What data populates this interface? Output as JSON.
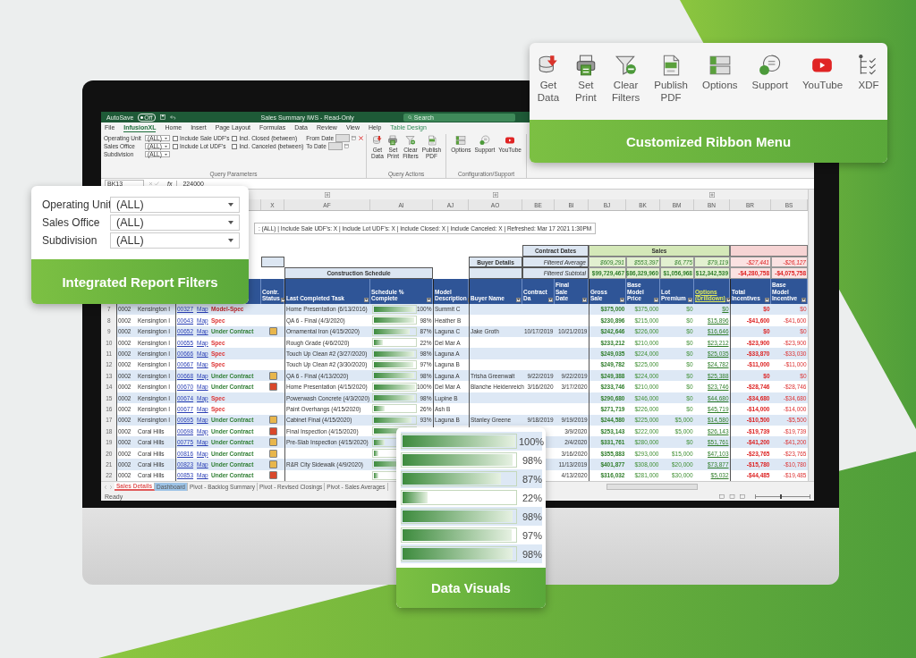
{
  "excel": {
    "title_bar": {
      "autosave": "AutoSave",
      "autosave_state": "Off",
      "autosave_on": false,
      "title": "Sales Summary IWS - Read-Only",
      "search_placeholder": "Search"
    },
    "menu": [
      {
        "label": "File",
        "selected": false,
        "kind": "tab"
      },
      {
        "label": "InfusionXL",
        "selected": true,
        "kind": "tab"
      },
      {
        "label": "Home",
        "selected": false,
        "kind": "tab"
      },
      {
        "label": "Insert",
        "selected": false,
        "kind": "tab"
      },
      {
        "label": "Page Layout",
        "selected": false,
        "kind": "tab"
      },
      {
        "label": "Formulas",
        "selected": false,
        "kind": "tab"
      },
      {
        "label": "Data",
        "selected": false,
        "kind": "tab"
      },
      {
        "label": "Review",
        "selected": false,
        "kind": "tab"
      },
      {
        "label": "View",
        "selected": false,
        "kind": "tab"
      },
      {
        "label": "Help",
        "selected": false,
        "kind": "tab"
      },
      {
        "label": "Table Design",
        "selected": false,
        "kind": "contextual"
      }
    ],
    "ribbon": {
      "filters": [
        {
          "label": "Operating Unit",
          "value": "(ALL)"
        },
        {
          "label": "Sales Office",
          "value": "(ALL)"
        },
        {
          "label": "Subdivision",
          "value": "(ALL)"
        }
      ],
      "checkboxes": [
        {
          "label": "Include Sale UDF's",
          "checked": false
        },
        {
          "label": "Include Lot UDF's",
          "checked": false
        },
        {
          "label": "Incl. Closed (between)",
          "checked": false
        },
        {
          "label": "Incl. Canceled (between)",
          "checked": false
        }
      ],
      "dates": [
        {
          "label": "From Date",
          "disabled": true
        },
        {
          "label": "To Date",
          "disabled": true
        }
      ],
      "query_parameters_label": "Query Parameters",
      "query_actions": {
        "label": "Query Actions",
        "buttons": [
          {
            "label": "Get Data",
            "kind": "database"
          },
          {
            "label": "Set Print",
            "kind": "printer"
          },
          {
            "label": "Clear Filters",
            "kind": "funnel"
          },
          {
            "label": "Publish PDF",
            "kind": "pdf"
          }
        ]
      },
      "configuration": {
        "label": "Configuration/Support",
        "buttons": [
          {
            "label": "Options",
            "kind": "options"
          },
          {
            "label": "Support",
            "kind": "support"
          },
          {
            "label": "YouTube",
            "kind": "youtube"
          }
        ]
      }
    },
    "formula_bar": {
      "name_box": "BK13",
      "function_label": "fx",
      "value": "224000"
    },
    "sheet": {
      "columns": [
        {
          "letter": "X",
          "heading": "Contr. Status"
        },
        {
          "letter": "AF",
          "heading": "Last Completed Task"
        },
        {
          "letter": "AI",
          "heading": "Schedule % Complete"
        },
        {
          "letter": "AJ",
          "heading": "Model Description"
        },
        {
          "letter": "AO",
          "heading": "Buyer Name"
        },
        {
          "letter": "BE",
          "heading": "Contract Da"
        },
        {
          "letter": "BI",
          "heading": "Final Sale Date"
        },
        {
          "letter": "BJ",
          "heading": "Gross Sale"
        },
        {
          "letter": "BK",
          "heading": "Base Model Price"
        },
        {
          "letter": "BM",
          "heading": "Lot Premium"
        },
        {
          "letter": "BN",
          "heading": "Options (Drilldown)"
        },
        {
          "letter": "BR",
          "heading": "Total Incentives"
        },
        {
          "letter": "BS",
          "heading": "Base Model Incentive"
        }
      ],
      "filter_summary": ": (ALL) | Include Sale UDF's: X | Include Lot UDF's: X | Include Closed: X | Include Canceled: X | Refreshed: Mar 17 2021 1:30PM",
      "groups": {
        "contract_dates": "Contract Dates",
        "sales": "Sales",
        "buyer_details": "Buyer Details",
        "construction_schedule": "Construction Schedule"
      },
      "filtered_average": {
        "label": "Filtered Average",
        "values": [
          "$609,291",
          "$553,397",
          "$6,775",
          "$79,119",
          "-$27,441",
          "-$26,127"
        ]
      },
      "filtered_subtotal": {
        "label": "Filtered Subtotal",
        "values": [
          "$99,729,467",
          "$86,329,960",
          "$1,056,968",
          "$12,342,539",
          "-$4,280,758",
          "-$4,075,758"
        ]
      },
      "rows": [
        {
          "number": "7",
          "unit": "0002",
          "community": "Kensington I",
          "lot": "00327",
          "map": "Map",
          "status": "Model-Spec",
          "kind": "model_spec",
          "task": "Home Presentation (6/13/2016)",
          "level": 1,
          "schedule": "100%",
          "model": "Summit C",
          "gross": "$375,000",
          "base_price": "$375,000",
          "lot_premium": "$0",
          "options": "$0",
          "total_incentives": "$0",
          "base_incentive": "$0"
        },
        {
          "number": "8",
          "unit": "0002",
          "community": "Kensington I",
          "lot": "00643",
          "map": "Map",
          "status": "Spec",
          "kind": "spec",
          "task": "QA 6 - Final (4/3/2020)",
          "level": 0.98,
          "schedule": "98%",
          "model": "Heather B",
          "gross": "$230,896",
          "base_price": "$215,000",
          "lot_premium": "$0",
          "options": "$15,896",
          "total_incentives": "-$41,600",
          "base_incentive": "-$41,600"
        },
        {
          "number": "9",
          "unit": "0002",
          "community": "Kensington I",
          "lot": "00652",
          "map": "Map",
          "status": "Under Contract",
          "kind": "under_contract",
          "color": "#e8b64c",
          "task": "Ornamental Iron (4/15/2020)",
          "level": 0.87,
          "schedule": "87%",
          "model": "Laguna C",
          "buyer": "Jake Groth",
          "contract_date": "10/17/2019",
          "final_date": "10/21/2019",
          "gross": "$242,646",
          "base_price": "$226,000",
          "lot_premium": "$0",
          "options": "$16,646",
          "total_incentives": "$0",
          "base_incentive": "$0"
        },
        {
          "number": "10",
          "unit": "0002",
          "community": "Kensington I",
          "lot": "00655",
          "map": "Map",
          "status": "Spec",
          "kind": "spec",
          "task": "Rough Grade (4/6/2020)",
          "level": 0.22,
          "schedule": "22%",
          "model": "Del Mar A",
          "gross": "$233,212",
          "base_price": "$210,000",
          "lot_premium": "$0",
          "options": "$23,212",
          "total_incentives": "-$23,900",
          "base_incentive": "-$23,900"
        },
        {
          "number": "11",
          "unit": "0002",
          "community": "Kensington I",
          "lot": "00666",
          "map": "Map",
          "status": "Spec",
          "kind": "spec",
          "task": "Touch Up Clean #2 (3/27/2020)",
          "level": 0.98,
          "schedule": "98%",
          "model": "Laguna A",
          "gross": "$249,035",
          "base_price": "$224,000",
          "lot_premium": "$0",
          "options": "$25,035",
          "total_incentives": "-$33,870",
          "base_incentive": "-$33,030"
        },
        {
          "number": "12",
          "unit": "0002",
          "community": "Kensington I",
          "lot": "00667",
          "map": "Map",
          "status": "Spec",
          "kind": "spec",
          "task": "Touch Up Clean #2 (3/30/2020)",
          "level": 0.97,
          "schedule": "97%",
          "model": "Laguna B",
          "gross": "$249,782",
          "base_price": "$225,000",
          "lot_premium": "$0",
          "options": "$24,782",
          "total_incentives": "-$11,000",
          "base_incentive": "-$11,000"
        },
        {
          "number": "13",
          "unit": "0002",
          "community": "Kensington I",
          "lot": "00668",
          "map": "Map",
          "status": "Under Contract",
          "kind": "under_contract",
          "color": "#e8b64c",
          "task": "QA 6 - Final (4/13/2020)",
          "level": 0.98,
          "schedule": "98%",
          "model": "Laguna A",
          "buyer": "Trisha Greenwalt",
          "contract_date": "9/22/2019",
          "final_date": "9/22/2019",
          "gross": "$249,388",
          "base_price": "$224,000",
          "lot_premium": "$0",
          "options": "$25,388",
          "total_incentives": "$0",
          "base_incentive": "$0"
        },
        {
          "number": "14",
          "unit": "0002",
          "community": "Kensington I",
          "lot": "00670",
          "map": "Map",
          "status": "Under Contract",
          "kind": "under_contract",
          "color": "#d9482b",
          "task": "Home Presentation (4/15/2020)",
          "level": 1,
          "schedule": "100%",
          "model": "Del Mar A",
          "buyer": "Blanche Heidenreich",
          "contract_date": "3/16/2020",
          "final_date": "3/17/2020",
          "gross": "$233,746",
          "base_price": "$210,000",
          "lot_premium": "$0",
          "options": "$23,746",
          "total_incentives": "-$28,746",
          "base_incentive": "-$28,746"
        },
        {
          "number": "15",
          "unit": "0002",
          "community": "Kensington I",
          "lot": "00674",
          "map": "Map",
          "status": "Spec",
          "kind": "spec",
          "task": "Powerwash Concrete (4/3/2020)",
          "level": 0.98,
          "schedule": "98%",
          "model": "Lupine B",
          "gross": "$290,680",
          "base_price": "$246,000",
          "lot_premium": "$0",
          "options": "$44,680",
          "total_incentives": "-$34,680",
          "base_incentive": "-$34,680"
        },
        {
          "number": "16",
          "unit": "0002",
          "community": "Kensington I",
          "lot": "00677",
          "map": "Map",
          "status": "Spec",
          "kind": "spec",
          "task": "Paint Overhangs (4/15/2020)",
          "level": 0.26,
          "schedule": "26%",
          "model": "Ash B",
          "gross": "$271,719",
          "base_price": "$226,000",
          "lot_premium": "$0",
          "options": "$45,719",
          "total_incentives": "-$14,000",
          "base_incentive": "-$14,000"
        },
        {
          "number": "17",
          "unit": "0002",
          "community": "Kensington I",
          "lot": "00695",
          "map": "Map",
          "status": "Under Contract",
          "kind": "under_contract",
          "color": "#e8b64c",
          "task": "Cabinet Final (4/15/2020)",
          "level": 0.93,
          "schedule": "93%",
          "model": "Laguna B",
          "buyer": "Stanley Greene",
          "contract_date": "9/18/2019",
          "final_date": "9/19/2019",
          "gross": "$244,580",
          "base_price": "$225,000",
          "lot_premium": "$5,000",
          "options": "$14,580",
          "total_incentives": "-$10,500",
          "base_incentive": "-$5,500"
        },
        {
          "number": "18",
          "unit": "0002",
          "community": "Coral Hills",
          "lot": "00698",
          "map": "Map",
          "status": "Under Contract",
          "kind": "under_contract",
          "color": "#d9482b",
          "task": "Final Inspection (4/15/2020)",
          "level": 0.95,
          "final_date": "3/9/2020",
          "gross": "$253,143",
          "base_price": "$222,000",
          "lot_premium": "$5,000",
          "options": "$26,143",
          "total_incentives": "-$19,739",
          "base_incentive": "-$19,739"
        },
        {
          "number": "19",
          "unit": "0002",
          "community": "Coral Hills",
          "lot": "00775",
          "map": "Map",
          "status": "Under Contract",
          "kind": "under_contract",
          "color": "#e8b64c",
          "task": "Pre-Slab Inspection (4/15/2020)",
          "level": 0.26,
          "final_date": "2/4/2020",
          "gross": "$331,761",
          "base_price": "$280,000",
          "lot_premium": "$0",
          "options": "$51,761",
          "total_incentives": "-$41,200",
          "base_incentive": "-$41,200"
        },
        {
          "number": "20",
          "unit": "0002",
          "community": "Coral Hills",
          "lot": "00816",
          "map": "Map",
          "status": "Under Contract",
          "kind": "under_contract",
          "color": "#e8b64c",
          "level": 0.1,
          "final_date": "3/16/2020",
          "gross": "$355,883",
          "base_price": "$293,000",
          "lot_premium": "$15,000",
          "options": "$47,103",
          "total_incentives": "-$23,765",
          "base_incentive": "-$23,765"
        },
        {
          "number": "21",
          "unit": "0002",
          "community": "Coral Hills",
          "lot": "00823",
          "map": "Map",
          "status": "Under Contract",
          "kind": "under_contract",
          "color": "#e8b64c",
          "task": "R&R City Sidewalk (4/9/2020)",
          "level": 0.9,
          "final_date": "11/13/2019",
          "gross": "$401,877",
          "base_price": "$308,000",
          "lot_premium": "$20,000",
          "options": "$73,877",
          "total_incentives": "-$15,780",
          "base_incentive": "-$10,780"
        },
        {
          "number": "22",
          "unit": "0002",
          "community": "Coral Hills",
          "lot": "00853",
          "map": "Map",
          "status": "Under Contract",
          "kind": "under_contract",
          "color": "#d9482b",
          "level": 0.1,
          "final_date": "4/13/2020",
          "gross": "$316,032",
          "base_price": "$281,000",
          "lot_premium": "$30,000",
          "options": "$5,032",
          "total_incentives": "-$44,485",
          "base_incentive": "-$19,485"
        }
      ],
      "sheet_tabs": [
        {
          "label": "Sales Details",
          "selected": true,
          "color": "#e05a5a"
        },
        {
          "label": "Dashboard",
          "selected": false,
          "color": "#9dc3e6"
        },
        {
          "label": "Pivot - Backlog Summary",
          "selected": false
        },
        {
          "label": "Pivot - Revised Closings",
          "selected": false
        },
        {
          "label": "Pivot - Sales Averages",
          "selected": false
        }
      ]
    },
    "status_bar": {
      "text": "Ready",
      "zoom_slider": {
        "level": 0.45
      }
    }
  },
  "callouts": {
    "filters": {
      "fields": [
        {
          "label": "Operating Unit",
          "value": "(ALL)"
        },
        {
          "label": "Sales Office",
          "value": "(ALL)"
        },
        {
          "label": "Subdivision",
          "value": "(ALL)"
        }
      ],
      "caption": "Integrated Report Filters"
    },
    "ribbon": {
      "buttons": [
        {
          "label": "Get Data",
          "kind": "database"
        },
        {
          "label": "Set Print",
          "kind": "printer"
        },
        {
          "label": "Clear Filters",
          "kind": "funnel"
        },
        {
          "label": "Publish PDF",
          "kind": "pdf"
        },
        {
          "label": "Options",
          "kind": "options"
        },
        {
          "label": "Support",
          "kind": "support"
        },
        {
          "label": "YouTube",
          "kind": "youtube"
        },
        {
          "label": "XDF",
          "kind": "tree"
        }
      ],
      "caption": "Customized Ribbon Menu"
    },
    "visuals": {
      "bars": [
        {
          "level": 1,
          "reading": "100%"
        },
        {
          "level": 0.98,
          "reading": "98%"
        },
        {
          "level": 0.87,
          "reading": "87%"
        },
        {
          "level": 0.22,
          "reading": "22%"
        },
        {
          "level": 0.98,
          "reading": "98%"
        },
        {
          "level": 0.97,
          "reading": "97%"
        },
        {
          "level": 0.98,
          "reading": "98%"
        }
      ],
      "caption": "Data Visuals"
    }
  }
}
